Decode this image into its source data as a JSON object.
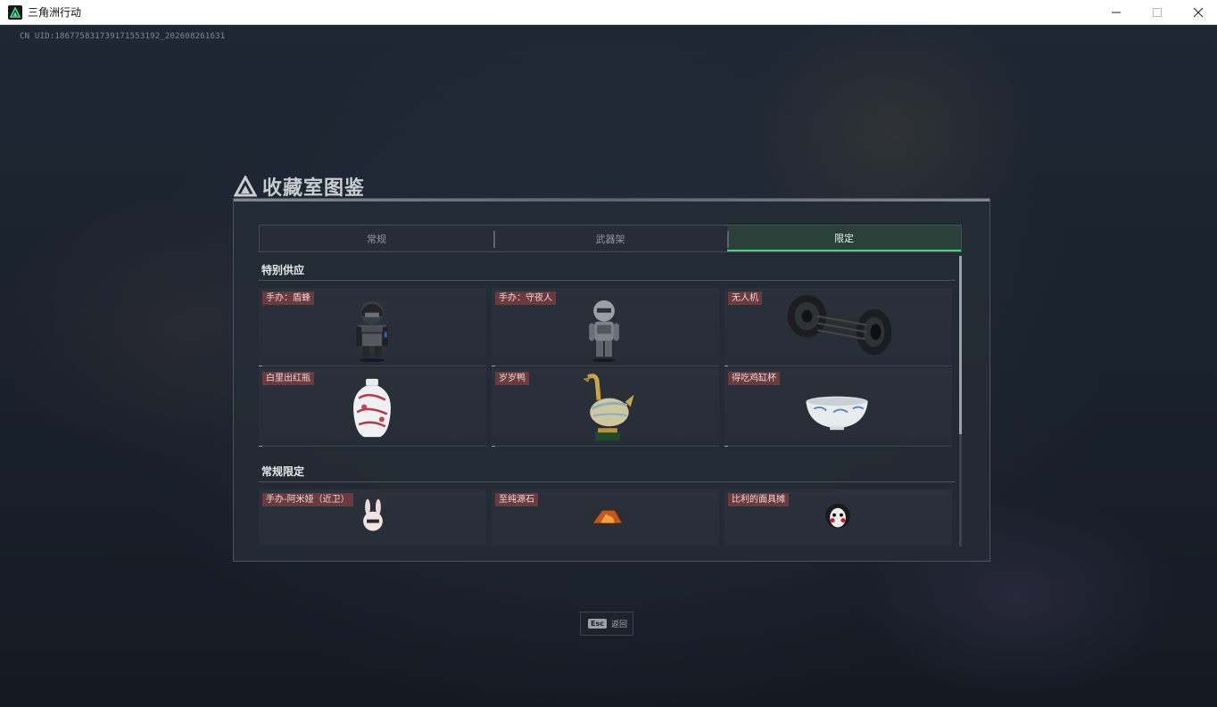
{
  "window": {
    "title": "三角洲行动",
    "icon": "delta-logo-icon",
    "controls": {
      "minimize": "minimize-icon",
      "maximize": "maximize-icon",
      "close": "close-icon"
    }
  },
  "uid_text": "CN UID:18677583173917155319​2_202608261631",
  "panel": {
    "title": "收藏室图鉴",
    "tabs": [
      {
        "label": "常规",
        "active": false
      },
      {
        "label": "武器架",
        "active": false
      },
      {
        "label": "限定",
        "active": true
      }
    ],
    "sections": [
      {
        "title": "特别供应",
        "items": [
          {
            "label": "手办：盾蜂",
            "icon": "figure-shield-bee-icon"
          },
          {
            "label": "手办：守夜人",
            "icon": "figure-nightwatch-icon"
          },
          {
            "label": "无人机",
            "icon": "drone-icon"
          },
          {
            "label": "白里出红瓶",
            "icon": "porcelain-vase-icon"
          },
          {
            "label": "岁岁鸭",
            "icon": "bronze-duck-icon"
          },
          {
            "label": "得吃鸡缸杯",
            "icon": "porcelain-cup-icon"
          }
        ]
      },
      {
        "title": "常规限定",
        "items": [
          {
            "label": "手办-阿米娅（近卫）",
            "icon": "figure-amiya-icon"
          },
          {
            "label": "至纯源石",
            "icon": "originium-icon"
          },
          {
            "label": "比利的面具摊",
            "icon": "billy-mask-icon"
          }
        ]
      }
    ]
  },
  "esc_hint": {
    "key": "Esc",
    "label": "返回"
  },
  "colors": {
    "accent": "#47d38d",
    "tag_bg": "#6b3a3f"
  }
}
